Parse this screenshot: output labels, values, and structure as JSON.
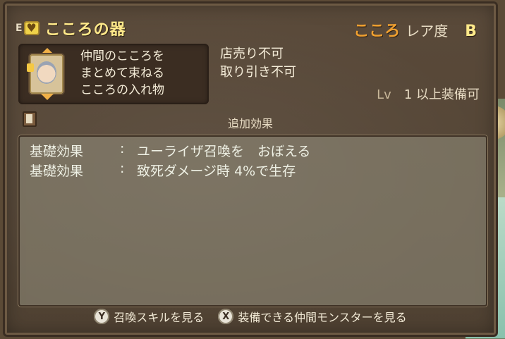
{
  "header": {
    "equip_marker": "E",
    "icon": "heart-icon",
    "item_name": "こころの器",
    "rarity_kokoro": "こころ",
    "rarity_label": "レア度",
    "rarity_grade": "B"
  },
  "description": {
    "lines": [
      "仲間のこころを",
      "まとめて束ねる",
      "こころの入れ物"
    ]
  },
  "restrictions": {
    "shop": "店売り不可",
    "trade": "取り引き不可"
  },
  "level": {
    "label": "Lv",
    "value": "1",
    "suffix": "以上装備可"
  },
  "effects": {
    "header": "追加効果",
    "rows": [
      {
        "category": "基礎効果",
        "sep": ":",
        "text": "ユーライザ召喚を　おぼえる"
      },
      {
        "category": "基礎効果",
        "sep": ":",
        "text": "致死ダメージ時 4%で生存"
      }
    ]
  },
  "footer": {
    "y_button": "Y",
    "y_label": "召喚スキルを見る",
    "x_button": "X",
    "x_label": "装備できる仲間モンスターを見る"
  },
  "colors": {
    "title": "#ffe98a",
    "kokoro": "#f0a030",
    "panel": "#4f4132"
  }
}
